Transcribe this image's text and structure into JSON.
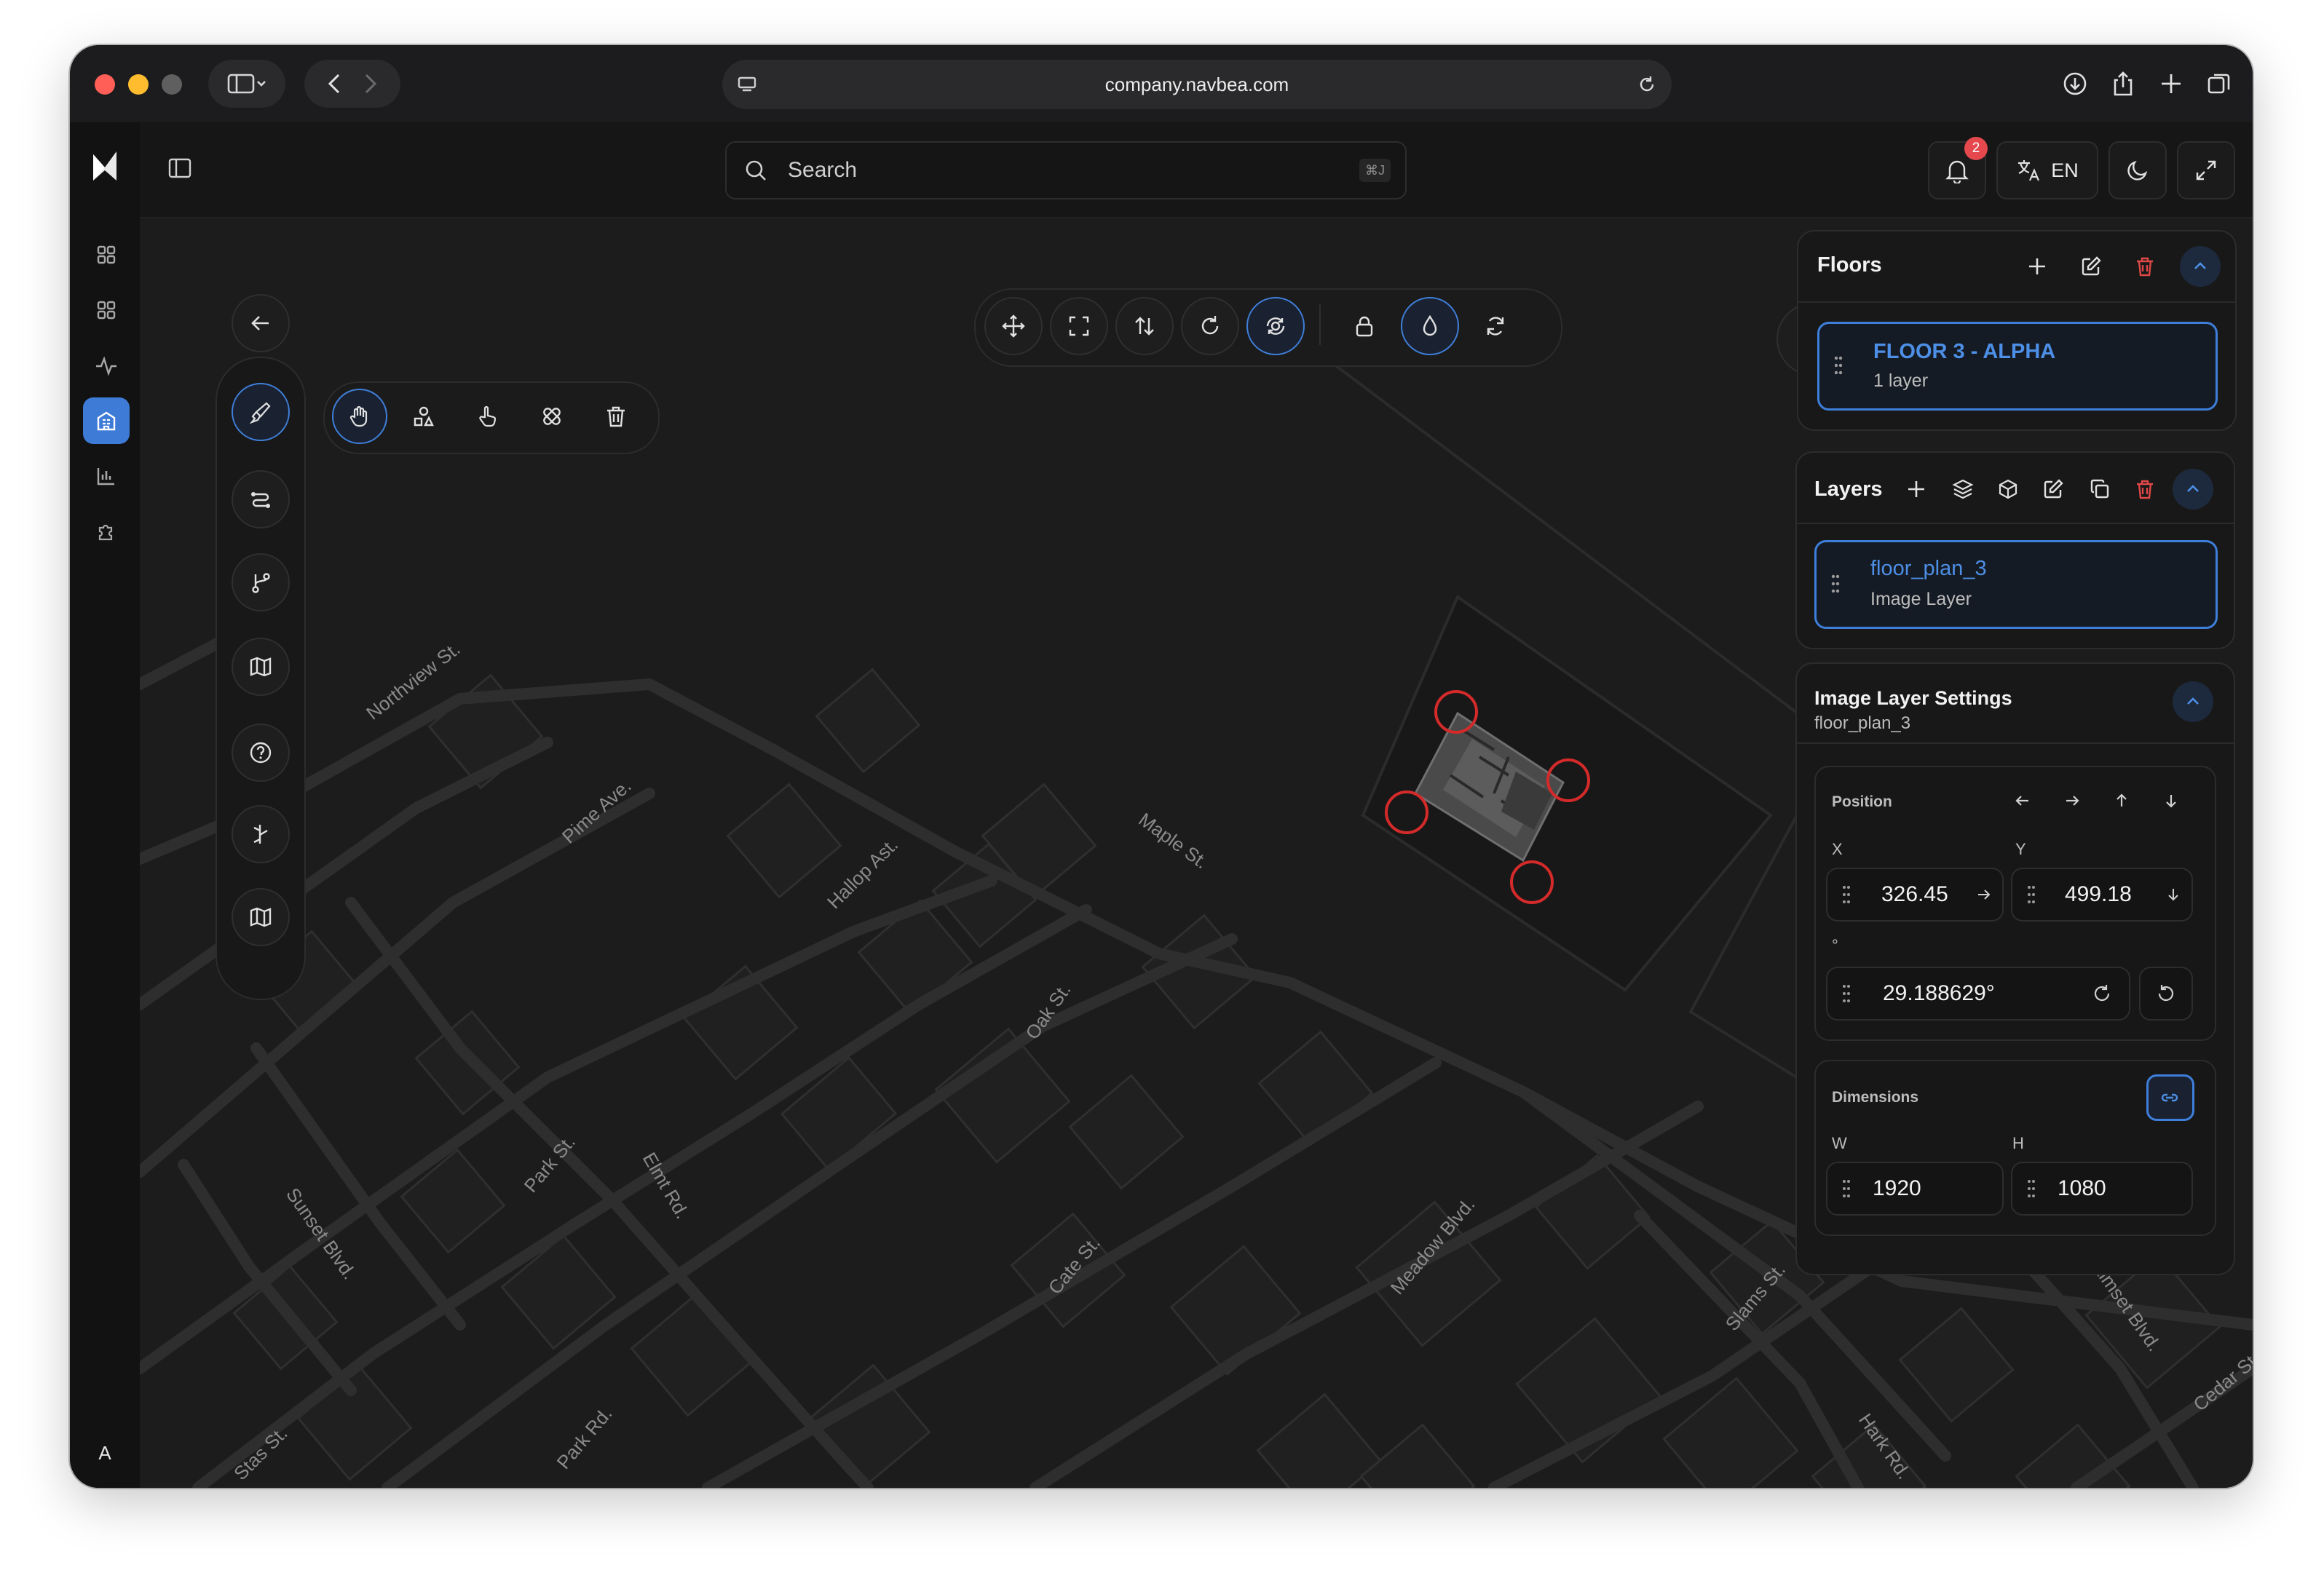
{
  "browser": {
    "url": "company.navbea.com"
  },
  "app": {
    "search_placeholder": "Search",
    "search_shortcut": "⌘J",
    "notifications_count": "2",
    "language": "EN",
    "user_initial": "A"
  },
  "rail": {
    "items": [
      "grid-icon",
      "apps-icon",
      "activity-icon",
      "building-icon",
      "chart-icon",
      "puzzle-icon"
    ],
    "active": "building-icon"
  },
  "map": {
    "streets": [
      "Northview St.",
      "Pime Ave.",
      "Hallop Ast.",
      "Maple St.",
      "Oak St.",
      "Park St.",
      "Elmt Rd.",
      "Sunset Blvd.",
      "Cate St.",
      "Meadow Blvd.",
      "Slams St.",
      "Aimset Blvd.",
      "Cedar St.",
      "Hark Rd.",
      "Park Rd.",
      "Stas St."
    ]
  },
  "floors": {
    "title": "Floors",
    "items": [
      {
        "name": "FLOOR 3 - ALPHA",
        "sub": "1 layer"
      }
    ]
  },
  "layers": {
    "title": "Layers",
    "items": [
      {
        "name": "floor_plan_3",
        "sub": "Image Layer"
      }
    ]
  },
  "settings": {
    "title": "Image Layer Settings",
    "subtitle": "floor_plan_3",
    "position": {
      "label": "Position",
      "x_label": "X",
      "y_label": "Y",
      "x": "326.45",
      "y": "499.18",
      "rot_label": "°",
      "rotation": "29.188629°"
    },
    "dimensions": {
      "label": "Dimensions",
      "w_label": "W",
      "h_label": "H",
      "w": "1920",
      "h": "1080"
    }
  },
  "colors": {
    "accent": "#3d7fda",
    "danger": "#e04848",
    "handle": "#d42a2a",
    "map_bg": "#1c1c1c"
  }
}
